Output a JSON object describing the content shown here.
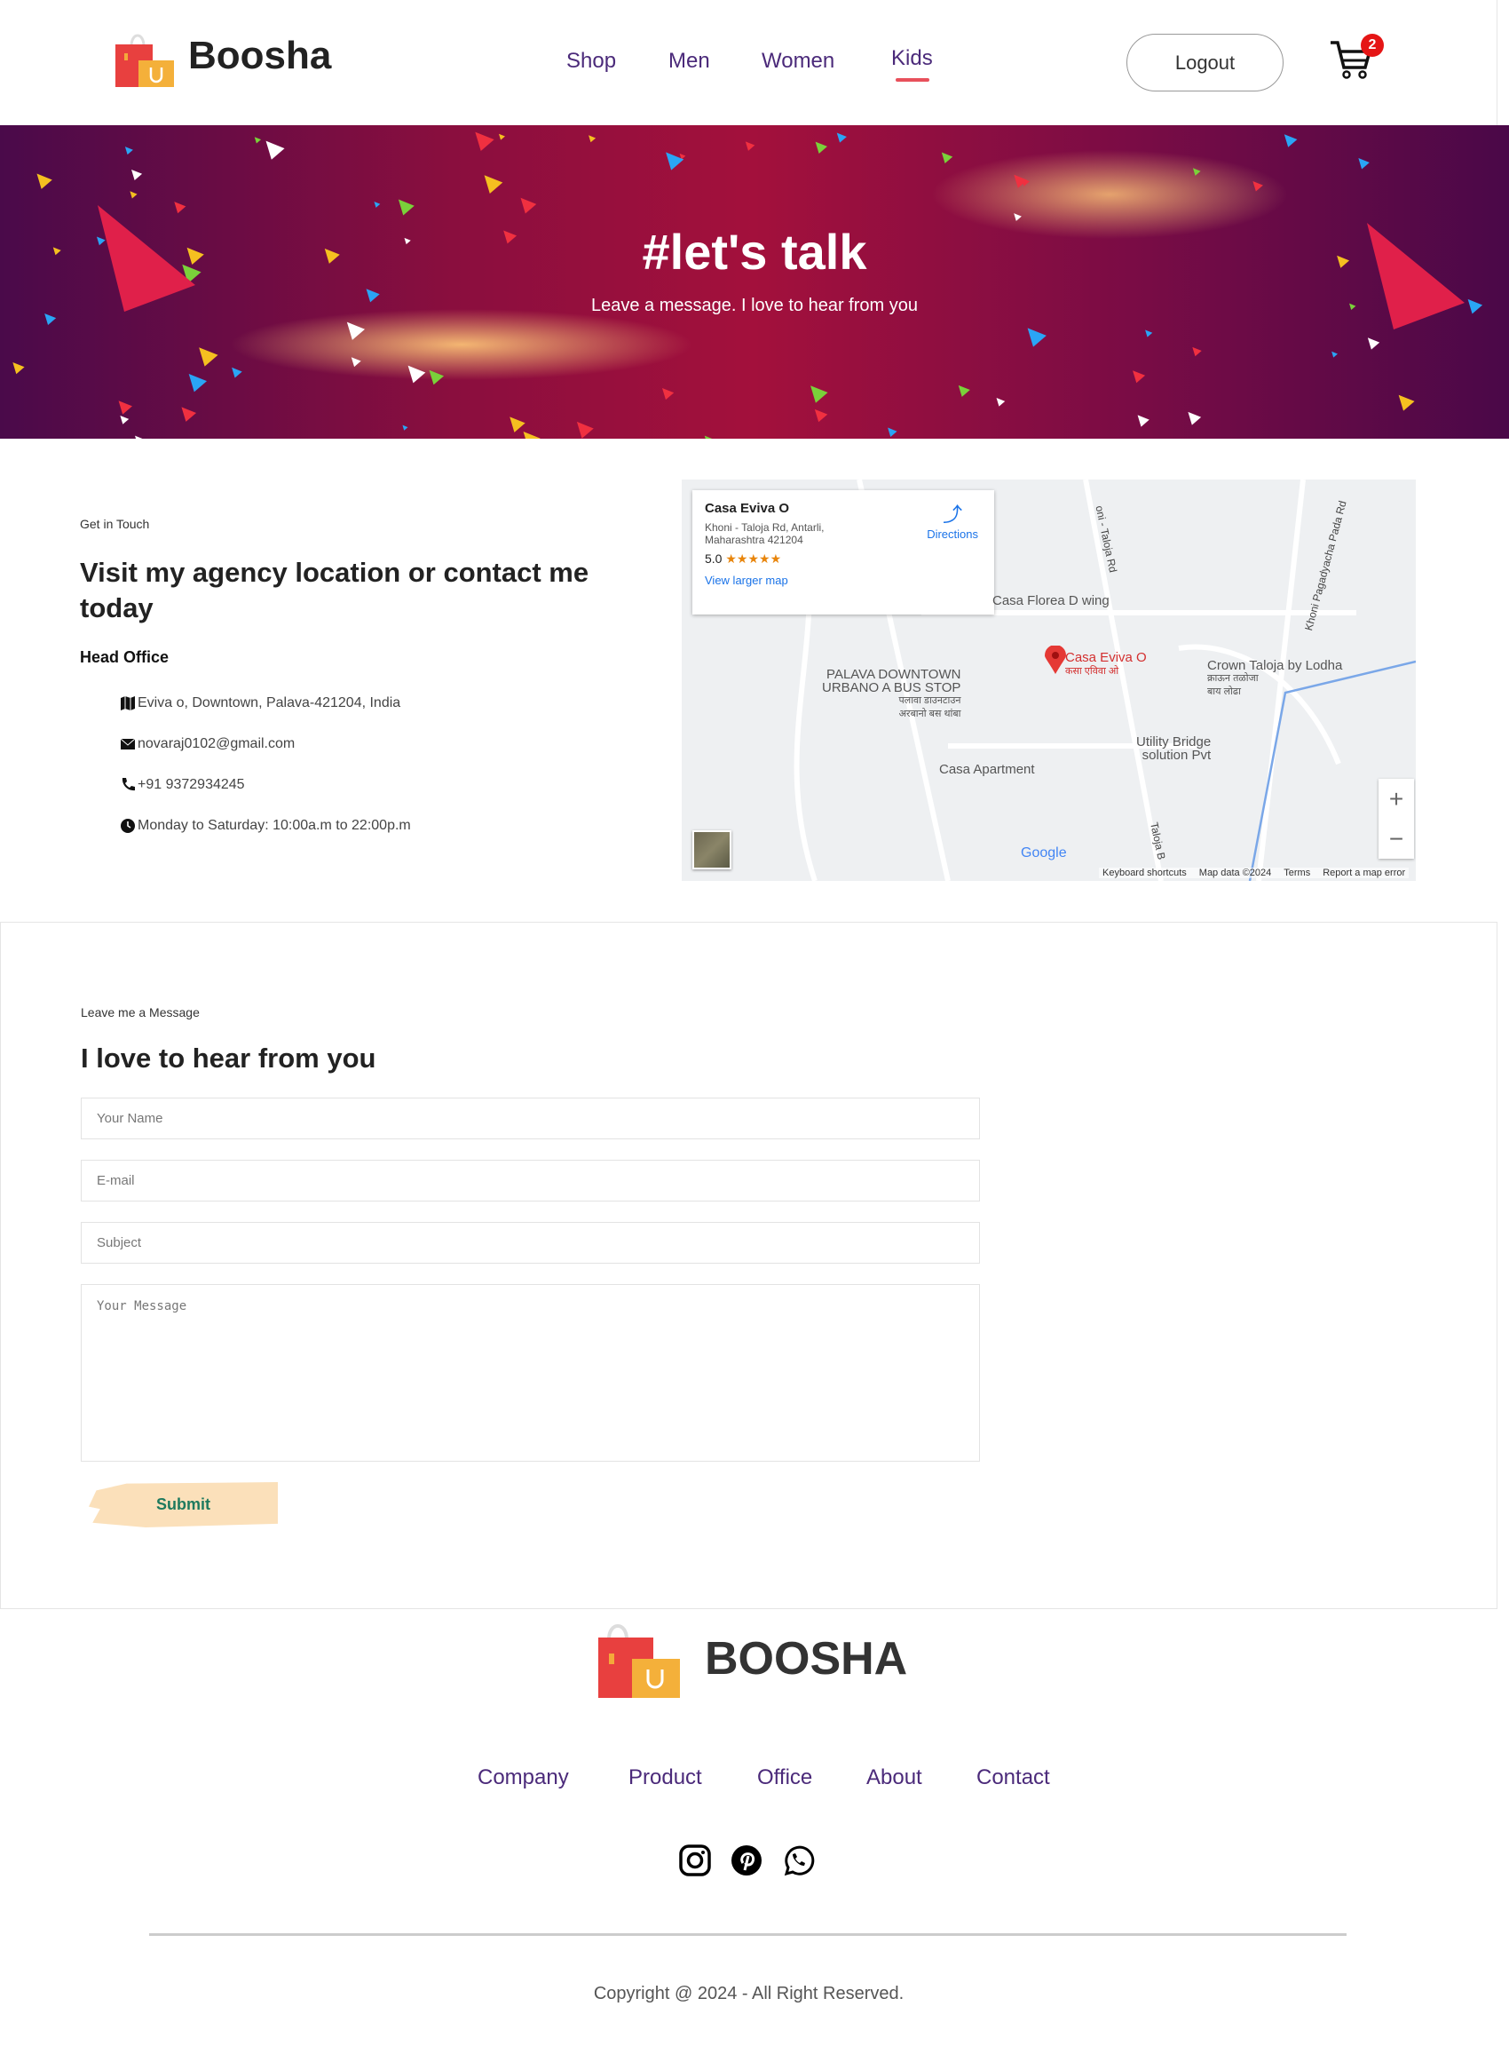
{
  "header": {
    "brand": "Boosha",
    "nav": [
      "Shop",
      "Men",
      "Women",
      "Kids"
    ],
    "active_nav": "Kids",
    "logout_label": "Logout",
    "cart_count": "2"
  },
  "banner": {
    "title": "#let's talk",
    "subtitle": "Leave a message. I love to hear from you"
  },
  "contact": {
    "eyebrow": "Get in Touch",
    "heading": "Visit my agency location or contact me today",
    "office_label": "Head Office",
    "items": [
      {
        "icon": "map-icon",
        "text": "Eviva o, Downtown, Palava-421204, India"
      },
      {
        "icon": "envelope-icon",
        "text": "novaraj0102@gmail.com"
      },
      {
        "icon": "phone-icon",
        "text": "+91 9372934245"
      },
      {
        "icon": "clock-icon",
        "text": "Monday to Saturday: 10:00a.m to 22:00p.m"
      }
    ]
  },
  "map": {
    "place_name": "Casa Eviva O",
    "address_line1": "Khoni - Taloja Rd, Antarli,",
    "address_line2": "Maharashtra 421204",
    "rating": "5.0",
    "stars": "★★★★★",
    "directions": "Directions",
    "view_larger": "View larger map",
    "labels": {
      "florea": "Casa Florea D wing",
      "pin": "Casa Eviva O",
      "pin_local": "कसा एविवा ओ",
      "palava1": "PALAVA DOWNTOWN",
      "palava2": "URBANO A BUS STOP",
      "palava_local1": "पलावा डाउनटाउन",
      "palava_local2": "अरबानो बस थांबा",
      "crown": "Crown Taloja by Lodha",
      "crown_local1": "क्राऊन तळोजा",
      "crown_local2": "बाय लोढा",
      "utility1": "Utility Bridge",
      "utility2": "solution Pvt",
      "apartment": "Casa Apartment",
      "road1": "oni - Taloja Rd",
      "road2": "Khoni Pagadyacha Pada Rd",
      "road3": "Taloja B"
    },
    "google": "Google",
    "footer": [
      "Keyboard shortcuts",
      "Map data ©2024",
      "Terms",
      "Report a map error"
    ],
    "zoom_in": "+",
    "zoom_out": "−"
  },
  "message": {
    "eyebrow": "Leave me a Message",
    "heading": "I love to hear from you",
    "name_placeholder": "Your Name",
    "email_placeholder": "E-mail",
    "subject_placeholder": "Subject",
    "message_placeholder": "Your Message",
    "submit": "Submit"
  },
  "footer": {
    "brand": "BOOSHA",
    "links": [
      "Company",
      "Product",
      "Office",
      "About",
      "Contact"
    ],
    "social": [
      "instagram-icon",
      "pinterest-icon",
      "whatsapp-icon"
    ],
    "copyright": "Copyright @ 2024 - All Right Reserved."
  },
  "colors": {
    "nav": "#4b2a7a",
    "accent": "#e8505b",
    "submit_bg": "#fbe0ba",
    "submit_text": "#1e7a5e"
  }
}
